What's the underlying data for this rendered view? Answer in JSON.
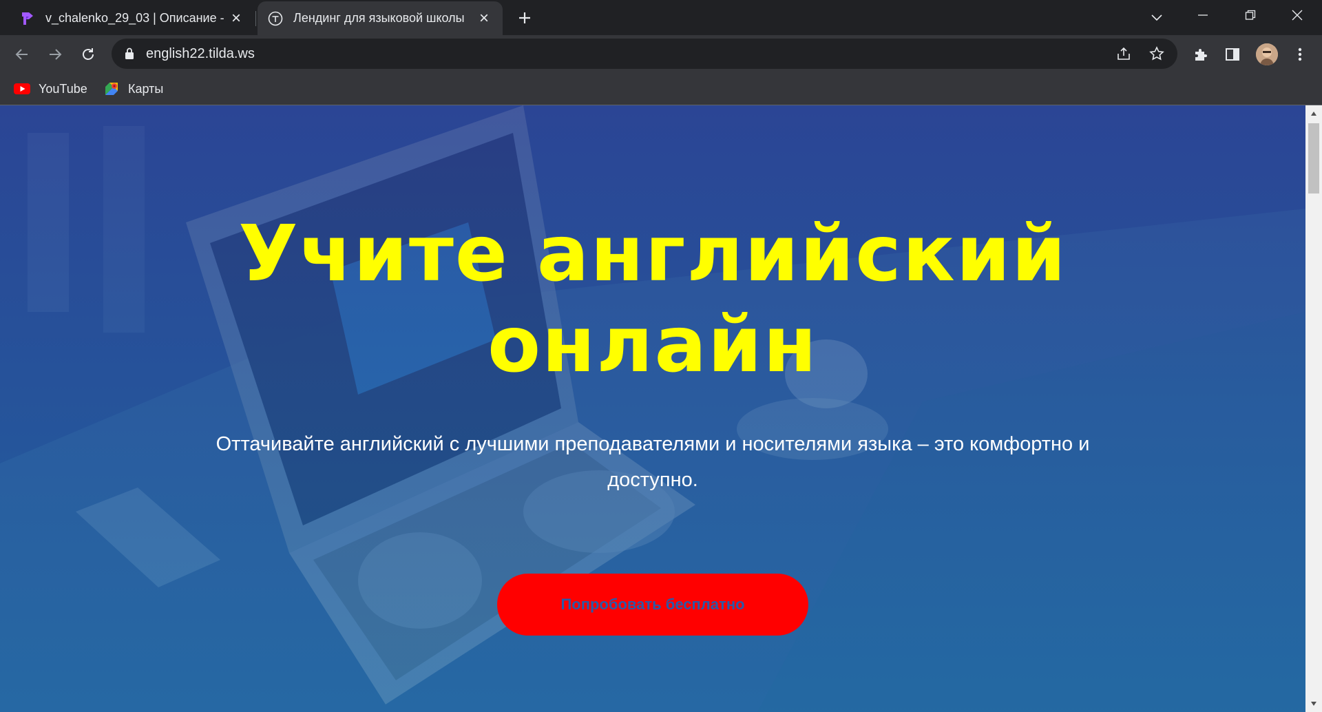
{
  "tabs": [
    {
      "title": "v_chalenko_29_03 | Описание - (",
      "active": false
    },
    {
      "title": "Лендинг для языковой школы",
      "active": true
    }
  ],
  "address_bar": {
    "url": "english22.tilda.ws"
  },
  "bookmarks": [
    {
      "label": "YouTube",
      "icon": "youtube-icon"
    },
    {
      "label": "Карты",
      "icon": "maps-icon"
    }
  ],
  "hero": {
    "title_line1": "Учите английский",
    "title_line2": "онлайн",
    "subtitle": "Оттачивайте английский с лучшими преподавателями и носителями языка – это комфортно и доступно.",
    "cta_label": "Попробовать бесплатно"
  },
  "colors": {
    "title": "#ffff00",
    "cta_background": "#ff0000",
    "cta_text": "#2a5aa8",
    "hero_overlay": "#23579d"
  }
}
